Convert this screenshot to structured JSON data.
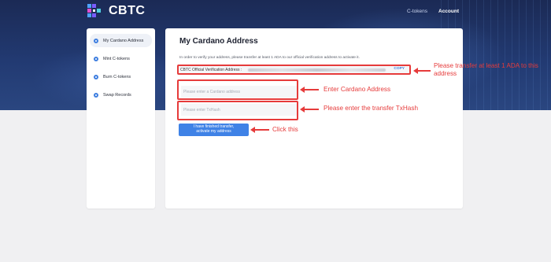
{
  "header": {
    "brand": "CBTC",
    "nav": [
      {
        "label": "C-tokens"
      },
      {
        "label": "Account"
      }
    ]
  },
  "sidebar": {
    "items": [
      {
        "label": "My Cardano Address",
        "active": true
      },
      {
        "label": "Mint C-tokens",
        "active": false
      },
      {
        "label": "Burn C-tokens",
        "active": false
      },
      {
        "label": "Swap Records",
        "active": false
      }
    ]
  },
  "main": {
    "title": "My Cardano Address",
    "intro": "In order to verify your address, please transfer at least 1 ADA to our official verification address to activate it.",
    "official_address_label": "CBTC Official Verification Address :",
    "copy_label": "COPY",
    "cardano_address_placeholder": "Please enter a Cardano address",
    "cardano_address_value": "",
    "txhash_placeholder": "Please enter TxHash",
    "txhash_value": "",
    "submit_line1": "I have finished transfer,",
    "submit_line2": "activate my address"
  },
  "annotations": {
    "a1": "Please transfer at least 1 ADA to this address",
    "a2": "Enter Cardano Address",
    "a3": "Please enter the transfer TxHash",
    "a4": "Click this"
  },
  "colors": {
    "accent": "#3f82e6",
    "annotation": "#e63b3b",
    "header_bg": "#1b2a55"
  }
}
